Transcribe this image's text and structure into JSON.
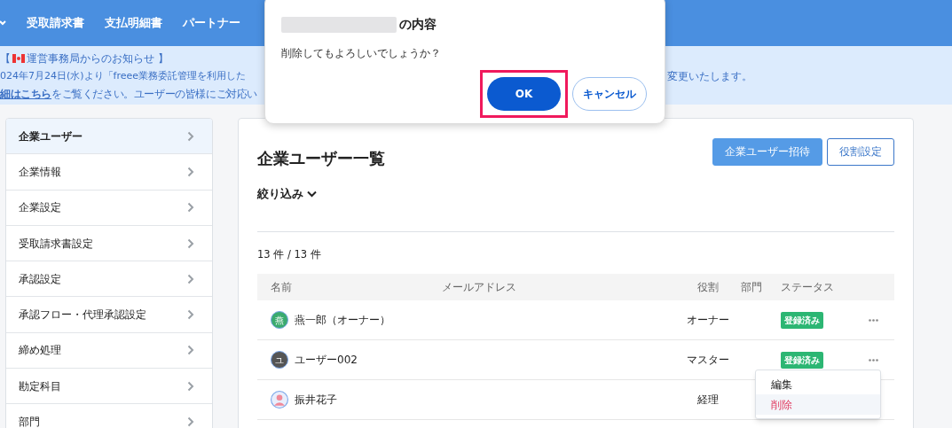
{
  "nav": {
    "items": [
      "受取請求書",
      "支払明細書",
      "パートナー"
    ]
  },
  "notice": {
    "title": "【 運営事務局からのお知らせ 】",
    "line_1_left": "024年7月24日(水)より「freee業務委託管理を利用した",
    "line_1_right": "変更いたします。",
    "line_2_link": "細はこちら",
    "line_2_rest": "をご覧ください。ユーザーの皆様にご対応い"
  },
  "sidebar": {
    "items": [
      {
        "label": "企業ユーザー",
        "selected": true
      },
      {
        "label": "企業情報",
        "selected": false
      },
      {
        "label": "企業設定",
        "selected": false
      },
      {
        "label": "受取請求書設定",
        "selected": false
      },
      {
        "label": "承認設定",
        "selected": false
      },
      {
        "label": "承認フロー・代理承認設定",
        "selected": false
      },
      {
        "label": "締め処理",
        "selected": false
      },
      {
        "label": "勘定科目",
        "selected": false
      },
      {
        "label": "部門",
        "selected": false
      }
    ]
  },
  "main": {
    "title": "企業ユーザー一覧",
    "buttons": [
      {
        "label": "企業ユーザー招待",
        "kind": "primary"
      },
      {
        "label": "役割設定",
        "kind": "outline"
      }
    ],
    "filter": "絞り込み",
    "count": "13 件 / 13 件",
    "table": {
      "columns": [
        "名前",
        "メールアドレス",
        "役割",
        "部門",
        "ステータス"
      ],
      "rows": [
        {
          "avatar": {
            "kind": "letter",
            "letter": "燕",
            "color": "#3aaa6e"
          },
          "name": "燕一郎（オーナー）",
          "role": "オーナー",
          "status": "登録済み",
          "menu": true
        },
        {
          "avatar": {
            "kind": "letter",
            "letter": "ユ",
            "color": "#555555"
          },
          "name": "ユーザー002",
          "role": "マスター",
          "status": "登録済み",
          "menu": true
        },
        {
          "avatar": {
            "kind": "figure",
            "color": "#f08a9a"
          },
          "name": "振井花子",
          "role": "経理"
        }
      ]
    },
    "row_menu": {
      "items": [
        {
          "label": "編集",
          "kind": "normal",
          "hovered": false
        },
        {
          "label": "削除",
          "kind": "danger",
          "hovered": true
        }
      ]
    }
  },
  "dialog": {
    "title": "の内容",
    "message": "削除してもよろしいでしょうか？",
    "buttons": [
      {
        "label": "OK",
        "kind": "primary",
        "highlighted": true
      },
      {
        "label": "キャンセル",
        "kind": "secondary",
        "highlighted": false
      }
    ]
  }
}
